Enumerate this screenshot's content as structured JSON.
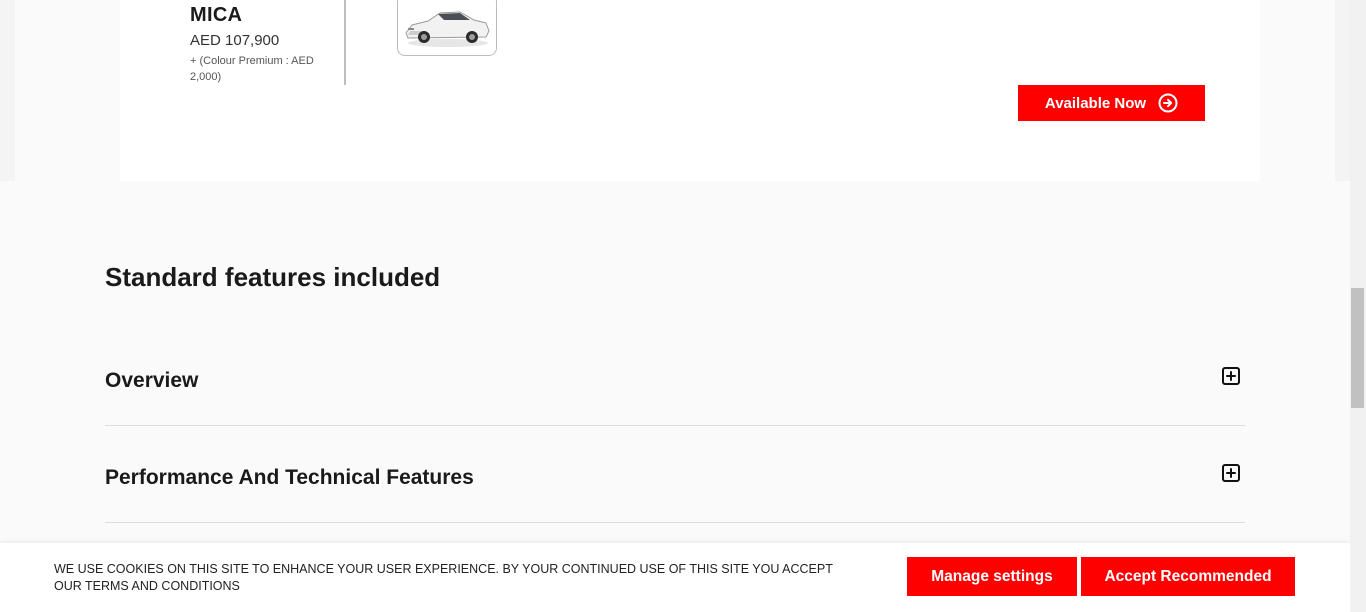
{
  "variant": {
    "color_name": "MICA",
    "price": "AED 107,900",
    "colour_premium": "+ (Colour Premium : AED 2,000)",
    "thumbnail": "car-thumbnail-white-sedan",
    "cta_label": "Available Now",
    "cta_icon": "arrow-right-circle-icon"
  },
  "features": {
    "title": "Standard features included",
    "items": [
      {
        "label": "Overview",
        "icon": "plus-square-icon"
      },
      {
        "label": "Performance And Technical Features",
        "icon": "plus-square-icon"
      }
    ]
  },
  "cookie_banner": {
    "text": "WE USE COOKIES ON THIS SITE TO ENHANCE YOUR USER EXPERIENCE. BY YOUR CONTINUED USE OF THIS SITE YOU ACCEPT OUR TERMS AND CONDITIONS",
    "manage_label": "Manage settings",
    "accept_label": "Accept Recommended"
  },
  "colors": {
    "accent": "#ff0000",
    "background": "#fafafa",
    "card": "#ffffff"
  }
}
